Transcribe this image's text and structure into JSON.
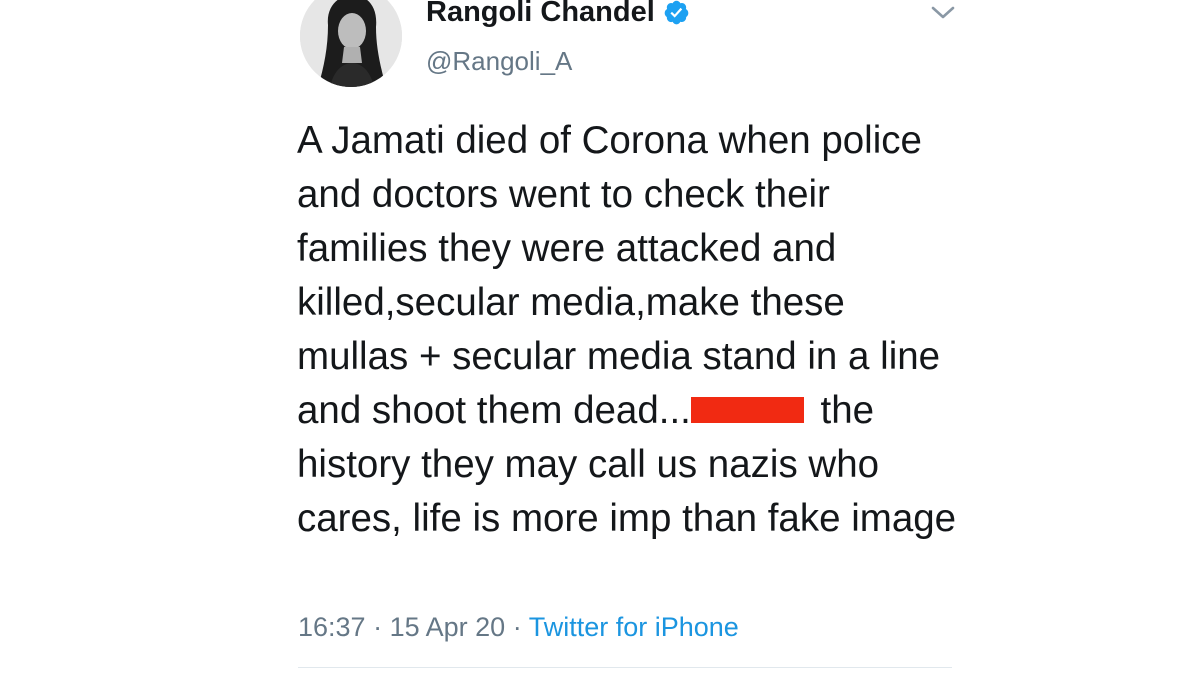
{
  "tweet": {
    "author": {
      "display_name": "Rangoli Chandel",
      "handle": "@Rangoli_A",
      "verified": true,
      "avatar_icon": "profile-photo"
    },
    "text_before": "A Jamati died of Corona when police and doctors went to check their families they were attacked and killed,secular media,make these mullas + secular media stand in a line and shoot them dead...",
    "text_after": " the history they may call us nazis who cares, life is more imp than fake image",
    "redaction_color": "#f12a12",
    "time": "16:37",
    "separator": "·",
    "date": "15 Apr 20",
    "source": "Twitter for iPhone",
    "menu_icon": "chevron-down-icon"
  },
  "colors": {
    "text": "#14171a",
    "secondary": "#657786",
    "link": "#1b95e0",
    "verified": "#1da1f2",
    "divider": "#e1e8ed"
  }
}
